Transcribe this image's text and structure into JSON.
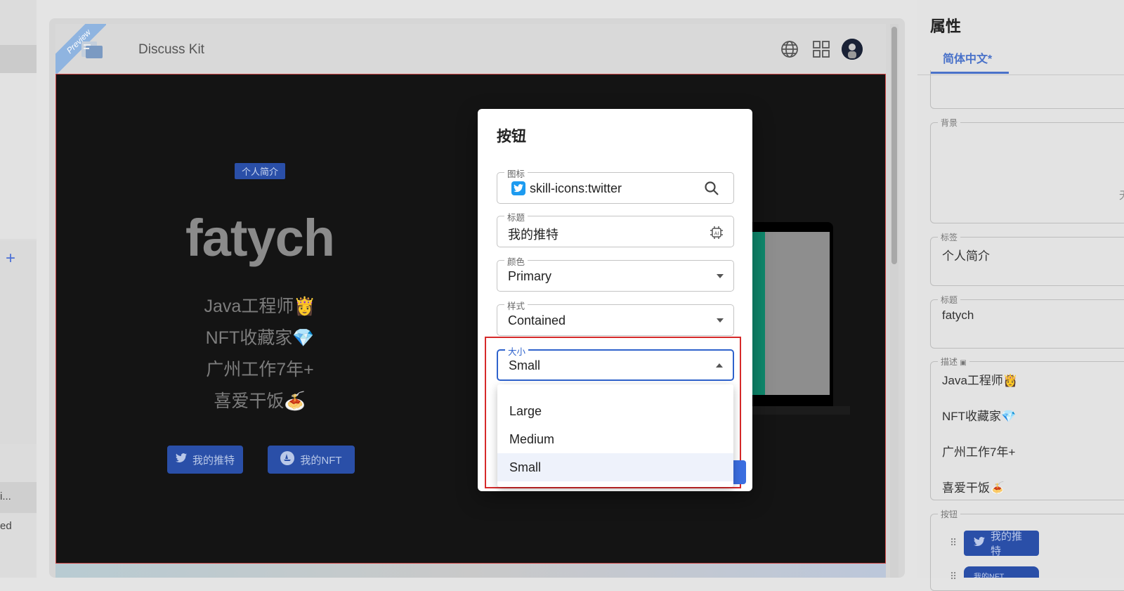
{
  "left": {
    "item1": "i...",
    "item2": "ed"
  },
  "header": {
    "ribbon": "Preview",
    "app_title": "Discuss Kit"
  },
  "profile": {
    "tag": "个人简介",
    "name": "fatych",
    "lines": [
      "Java工程师👸",
      "NFT收藏家💎",
      "广州工作7年+",
      "喜爱干饭🍝"
    ],
    "buttons": [
      "我的推特",
      "我的NFT"
    ]
  },
  "modal": {
    "title": "按钮",
    "icon_label": "图标",
    "icon_value": "skill-icons:twitter",
    "title_label": "标题",
    "title_value": "我的推特",
    "color_label": "颜色",
    "color_value": "Primary",
    "style_label": "样式",
    "style_value": "Contained",
    "size_label": "大小",
    "size_value": "Small",
    "size_options": [
      "Large",
      "Medium",
      "Small"
    ]
  },
  "panel": {
    "title": "属性",
    "lang_tab": "简体中文*",
    "bg_label": "背景",
    "bg_fragment": "无",
    "tag_label": "标签",
    "tag_value": "个人简介",
    "title_label": "标题",
    "title_value": "fatych",
    "desc_label": "描述",
    "desc_lines": [
      "Java工程师👸",
      "NFT收藏家💎",
      "广州工作7年+",
      "喜爱干饭🍝"
    ],
    "buttons_label": "按钮",
    "button1": "我的推特",
    "button2": "我的NFT"
  },
  "colors": {
    "accent": "#2f63cc",
    "highlight": "#d62a2a",
    "canvas": "#141414"
  }
}
